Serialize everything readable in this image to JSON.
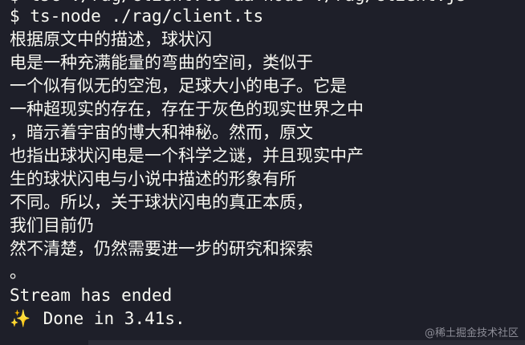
{
  "terminal": {
    "previous_line": "$ tsc ./rag/client.ts && node ./rag/client.js",
    "prompt": "$",
    "command": "ts-node ./rag/client.ts",
    "output_lines": [
      "根据原文中的描述，球状闪",
      "电是一种充满能量的弯曲的空间，类似于",
      "一个似有似无的空泡，足球大小的电子。它是",
      "一种超现实的存在，存在于灰色的现实世界之中",
      "，暗示着宇宙的博大和神秘。然而，原文",
      "也指出球状闪电是一个科学之谜，并且现实中产",
      "生的球状闪电与小说中描述的形象有所",
      "不同。所以，关于球状闪电的真正本质，",
      "我们目前仍",
      "然不清楚，仍然需要进一步的研究和探索",
      "。"
    ],
    "stream_status": "Stream has ended",
    "done_icon": "sparkles-icon",
    "done_glyph": "✨",
    "done_text": "Done in 3.41s."
  },
  "watermark": {
    "text": "@稀土掘金技术社区"
  },
  "colors": {
    "background": "#1e1f29",
    "foreground": "#f8f8f2",
    "accent": "#e7c74a"
  }
}
